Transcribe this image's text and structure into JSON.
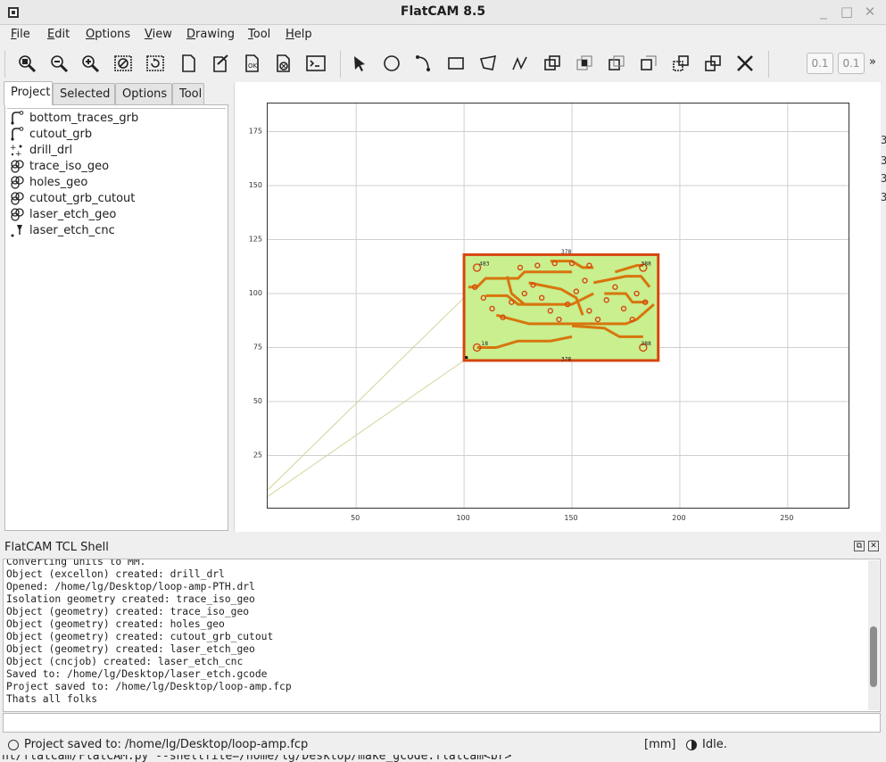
{
  "window": {
    "title": "FlatCAM 8.5",
    "controls": [
      "_",
      "□",
      "✕"
    ]
  },
  "menu": [
    {
      "label": "File",
      "key": "F"
    },
    {
      "label": "Edit",
      "key": "E"
    },
    {
      "label": "Options",
      "key": "O"
    },
    {
      "label": "View",
      "key": "V"
    },
    {
      "label": "Drawing",
      "key": "D"
    },
    {
      "label": "Tool",
      "key": "T"
    },
    {
      "label": "Help",
      "key": "H"
    }
  ],
  "toolbar": {
    "buttons": [
      "zoom-fit-icon",
      "zoom-out-icon",
      "zoom-in-icon",
      "clear-plot-icon",
      "replot-icon",
      "new-file-icon",
      "edit-file-icon",
      "ok-icon",
      "delete-icon",
      "shell-icon",
      "select-icon",
      "circle-icon",
      "arc-icon",
      "rectangle-icon",
      "polygon-icon",
      "path-icon",
      "union-icon",
      "intersection-icon",
      "subtract-icon",
      "cut-icon",
      "copy-icon",
      "move-icon",
      "close-icon"
    ],
    "grid_x": "0.1",
    "grid_y": "0.1",
    "more": "»"
  },
  "tabs": [
    "Project",
    "Selected",
    "Options",
    "Tool"
  ],
  "active_tab": "Project",
  "project_items": [
    {
      "name": "bottom_traces_grb",
      "icon": "gerber-icon"
    },
    {
      "name": "cutout_grb",
      "icon": "gerber-icon"
    },
    {
      "name": "drill_drl",
      "icon": "excellon-icon"
    },
    {
      "name": "trace_iso_geo",
      "icon": "geometry-icon"
    },
    {
      "name": "holes_geo",
      "icon": "geometry-icon"
    },
    {
      "name": "cutout_grb_cutout",
      "icon": "geometry-icon"
    },
    {
      "name": "laser_etch_geo",
      "icon": "geometry-icon"
    },
    {
      "name": "laser_etch_cnc",
      "icon": "cncjob-icon"
    }
  ],
  "plot": {
    "x_ticks": [
      "50",
      "100",
      "150",
      "200",
      "250"
    ],
    "y_ticks": [
      "25",
      "50",
      "75",
      "100",
      "125",
      "150",
      "175"
    ],
    "xlim": [
      9,
      279
    ],
    "ylim": [
      0,
      188
    ],
    "board": {
      "x": [
        100,
        190
      ],
      "y": [
        69,
        118
      ]
    },
    "hole_labels": [
      "483",
      "388",
      "18",
      "388"
    ],
    "top_label": "378",
    "bottom_label": "378",
    "colors": {
      "board_fill": "#c9ef8f",
      "board_outline": "#d7460f",
      "trace": "#d8750d",
      "travel": "#d4d49a"
    }
  },
  "shell": {
    "title": "FlatCAM TCL Shell",
    "log": [
      "Converting units to MM.",
      "Object (excellon) created: drill_drl",
      "Opened: /home/lg/Desktop/loop-amp-PTH.drl",
      "Isolation geometry created: trace_iso_geo",
      "Object (geometry) created: trace_iso_geo",
      "Object (geometry) created: holes_geo",
      "Object (geometry) created: cutout_grb_cutout",
      "Object (geometry) created: laser_etch_geo",
      "Object (cncjob) created: laser_etch_cnc",
      "Saved to: /home/lg/Desktop/laser_etch.gcode",
      "Project saved to: /home/lg/Desktop/loop-amp.fcp",
      "Thats all folks"
    ],
    "input_value": ""
  },
  "status": {
    "message": "Project saved to: /home/lg/Desktop/loop-amp.fcp",
    "units": "[mm]",
    "state": "Idle."
  },
  "behind_window_text": "nt/flatcam/FlatCAM.py --shellfile=/home/lg/Desktop/make_gcode.flatcam<br>",
  "edge_fragments": [
    "3",
    "3",
    "3",
    "3"
  ]
}
